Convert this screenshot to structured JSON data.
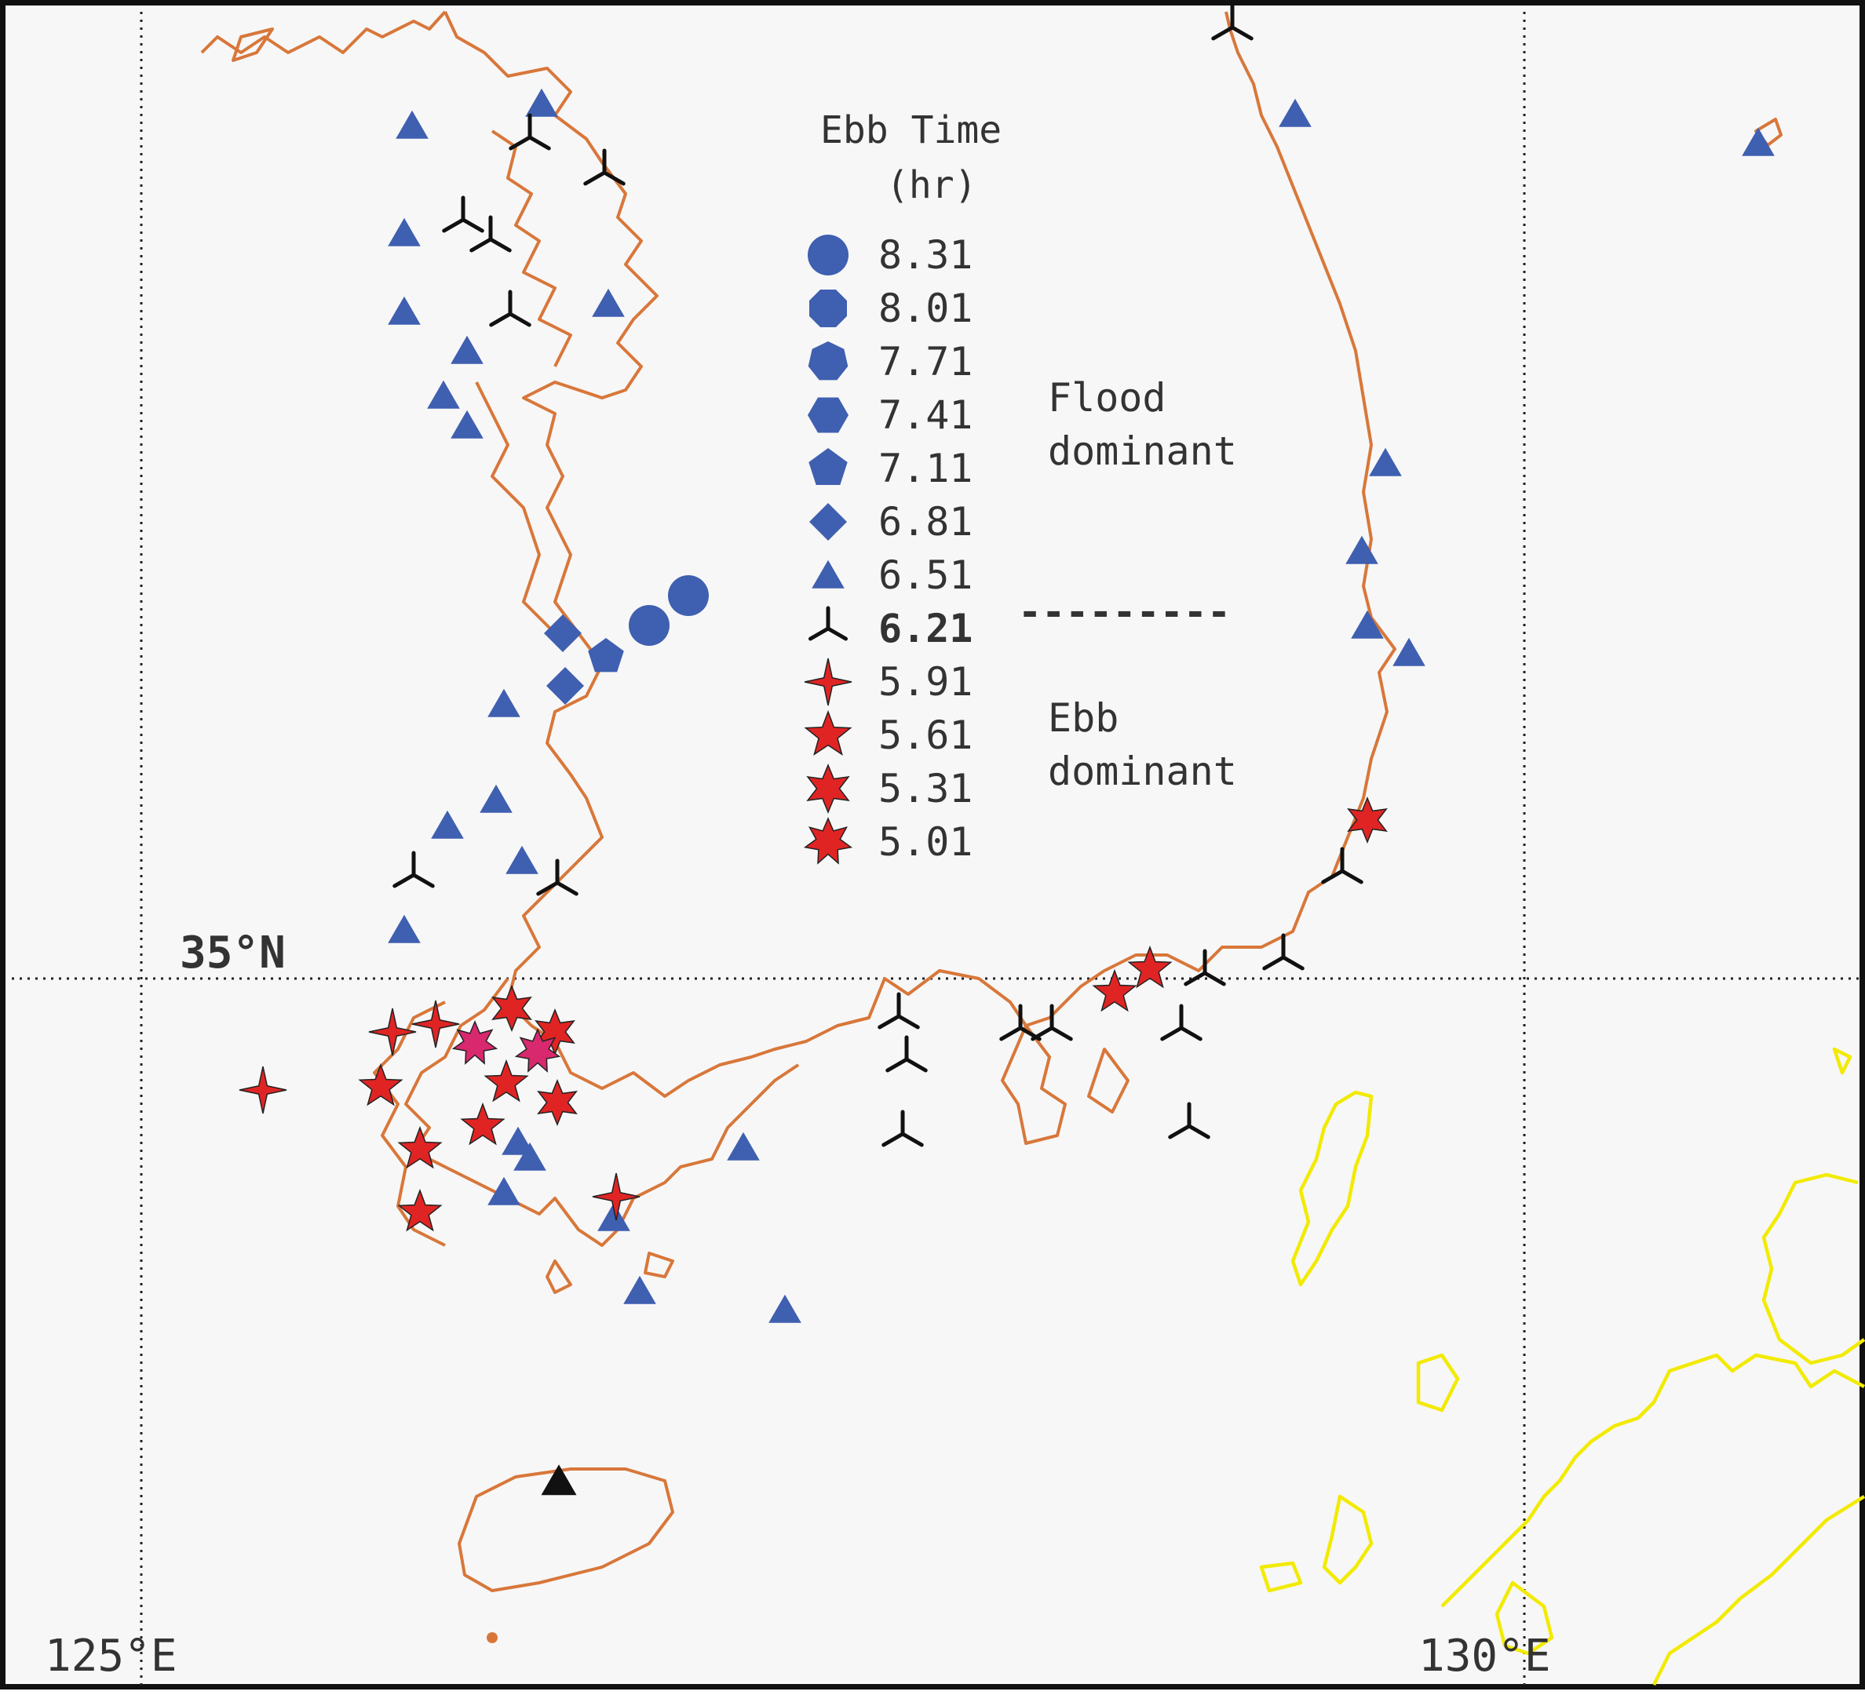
{
  "map": {
    "labels": {
      "lat_35": "35°N",
      "lon_125": "125°E",
      "lon_130": "130°E"
    },
    "colors": {
      "korea_coast": "#d8773a",
      "japan_coast": "#f2ea00",
      "flood_marker": "#3f5fb0",
      "ebb_marker": "#e02424",
      "ebb_marker_magenta": "#d8286e",
      "neutral_marker": "#111111"
    },
    "legend": {
      "title_line1": "Ebb Time",
      "title_line2": "(hr)",
      "items": [
        {
          "value": "8.31",
          "symbol": "circle-icon"
        },
        {
          "value": "8.01",
          "symbol": "octagon-icon"
        },
        {
          "value": "7.71",
          "symbol": "heptagon-icon"
        },
        {
          "value": "7.41",
          "symbol": "hexagon-icon"
        },
        {
          "value": "7.11",
          "symbol": "pentagon-icon"
        },
        {
          "value": "6.81",
          "symbol": "diamond-icon"
        },
        {
          "value": "6.51",
          "symbol": "triangle-icon"
        },
        {
          "value": "6.21",
          "symbol": "tri-spoke-icon"
        },
        {
          "value": "5.91",
          "symbol": "star4-icon"
        },
        {
          "value": "5.61",
          "symbol": "star5-icon"
        },
        {
          "value": "5.31",
          "symbol": "star6-icon"
        },
        {
          "value": "5.01",
          "symbol": "star7-icon"
        }
      ],
      "flood_label_1": "Flood",
      "flood_label_2": "dominant",
      "ebb_label_1": "Ebb",
      "ebb_label_2": "dominant",
      "divider": "---------"
    }
  }
}
